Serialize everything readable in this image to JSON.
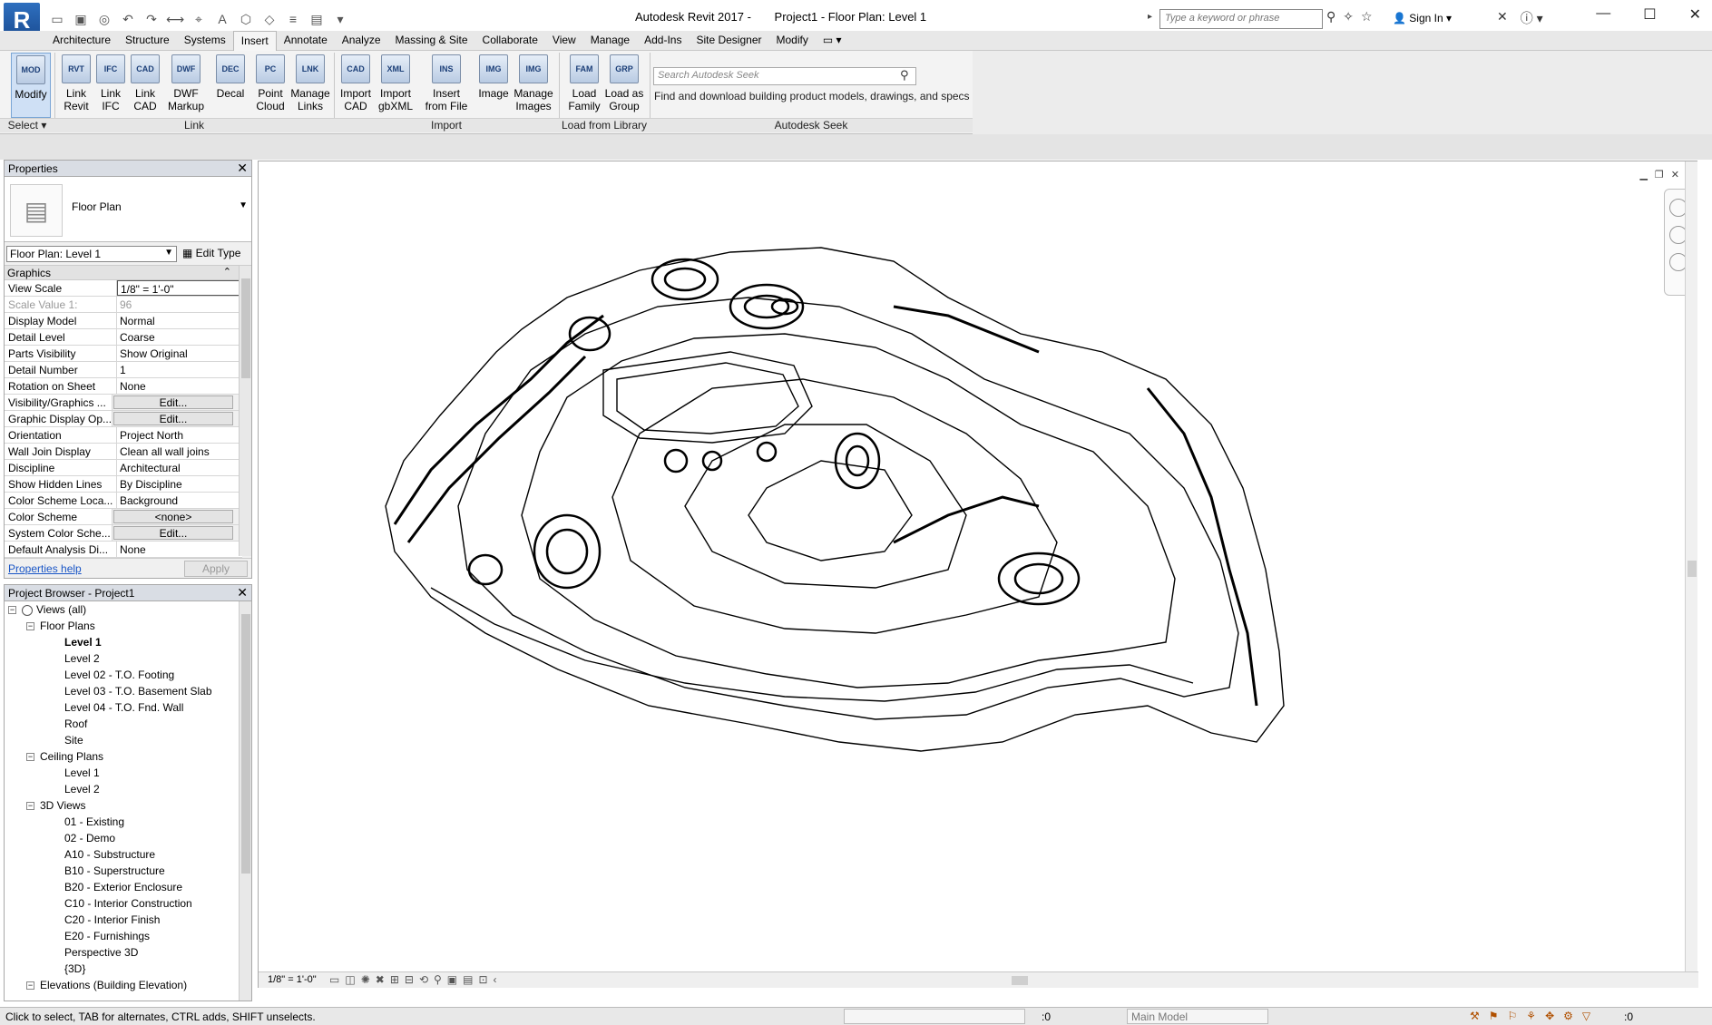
{
  "window": {
    "app_name": "Autodesk Revit 2017 -",
    "doc_title": "Project1 - Floor Plan: Level 1",
    "search_placeholder": "Type a keyword or phrase",
    "sign_in": "Sign In"
  },
  "ribbon_tabs": [
    "Architecture",
    "Structure",
    "Systems",
    "Insert",
    "Annotate",
    "Analyze",
    "Massing & Site",
    "Collaborate",
    "View",
    "Manage",
    "Add-Ins",
    "Site Designer",
    "Modify"
  ],
  "active_tab": "Insert",
  "ribbon": {
    "buttons": [
      {
        "label": "Modify",
        "icon": "MOD"
      },
      {
        "label": "Link Revit",
        "icon": "RVT"
      },
      {
        "label": "Link IFC",
        "icon": "IFC"
      },
      {
        "label": "Link CAD",
        "icon": "CAD"
      },
      {
        "label": "DWF Markup",
        "icon": "DWF"
      },
      {
        "label": "Decal",
        "icon": "DEC"
      },
      {
        "label": "Point Cloud",
        "icon": "PC"
      },
      {
        "label": "Manage Links",
        "icon": "LNK"
      },
      {
        "label": "Import CAD",
        "icon": "CAD"
      },
      {
        "label": "Import gbXML",
        "icon": "XML"
      },
      {
        "label": "Insert from File",
        "icon": "INS"
      },
      {
        "label": "Image",
        "icon": "IMG"
      },
      {
        "label": "Manage Images",
        "icon": "IMG"
      },
      {
        "label": "Load Family",
        "icon": "FAM"
      },
      {
        "label": "Load as Group",
        "icon": "GRP"
      }
    ],
    "panels": [
      "Select",
      "Link",
      "Import",
      "Load from Library",
      "Autodesk Seek"
    ],
    "seek_placeholder": "Search Autodesk Seek",
    "seek_description": "Find and download building product models, drawings, and specs"
  },
  "properties": {
    "title": "Properties",
    "type_name": "Floor Plan",
    "instance": "Floor Plan: Level 1",
    "edit_type": "Edit Type",
    "group": "Graphics",
    "rows": [
      {
        "name": "View Scale",
        "value": "1/8\" = 1'-0\""
      },
      {
        "name": "Scale Value    1:",
        "value": "96"
      },
      {
        "name": "Display Model",
        "value": "Normal"
      },
      {
        "name": "Detail Level",
        "value": "Coarse"
      },
      {
        "name": "Parts Visibility",
        "value": "Show Original"
      },
      {
        "name": "Detail Number",
        "value": "1"
      },
      {
        "name": "Rotation on Sheet",
        "value": "None"
      },
      {
        "name": "Visibility/Graphics ...",
        "value": "Edit..."
      },
      {
        "name": "Graphic Display Op...",
        "value": "Edit..."
      },
      {
        "name": "Orientation",
        "value": "Project North"
      },
      {
        "name": "Wall Join Display",
        "value": "Clean all wall joins"
      },
      {
        "name": "Discipline",
        "value": "Architectural"
      },
      {
        "name": "Show Hidden Lines",
        "value": "By Discipline"
      },
      {
        "name": "Color Scheme Loca...",
        "value": "Background"
      },
      {
        "name": "Color Scheme",
        "value": "<none>"
      },
      {
        "name": "System Color Sche...",
        "value": "Edit..."
      },
      {
        "name": "Default Analysis Di...",
        "value": "None"
      }
    ],
    "help": "Properties help",
    "apply": "Apply"
  },
  "browser": {
    "title": "Project Browser - Project1",
    "nodes": [
      {
        "label": "Views (all)",
        "level": 0,
        "exp": "−"
      },
      {
        "label": "Floor Plans",
        "level": 1,
        "exp": "−"
      },
      {
        "label": "Level 1",
        "level": 2
      },
      {
        "label": "Level 2",
        "level": 2
      },
      {
        "label": "Level 02 - T.O. Footing",
        "level": 2
      },
      {
        "label": "Level 03 - T.O. Basement Slab",
        "level": 2
      },
      {
        "label": "Level 04 - T.O. Fnd. Wall",
        "level": 2
      },
      {
        "label": "Roof",
        "level": 2
      },
      {
        "label": "Site",
        "level": 2
      },
      {
        "label": "Ceiling Plans",
        "level": 1,
        "exp": "−"
      },
      {
        "label": "Level 1",
        "level": 2
      },
      {
        "label": "Level 2",
        "level": 2
      },
      {
        "label": "3D Views",
        "level": 1,
        "exp": "−"
      },
      {
        "label": "01 - Existing",
        "level": 2
      },
      {
        "label": "02 - Demo",
        "level": 2
      },
      {
        "label": "A10 - Substructure",
        "level": 2
      },
      {
        "label": "B10 - Superstructure",
        "level": 2
      },
      {
        "label": "B20 - Exterior Enclosure",
        "level": 2
      },
      {
        "label": "C10 - Interior Construction",
        "level": 2
      },
      {
        "label": "C20 - Interior Finish",
        "level": 2
      },
      {
        "label": "E20 - Furnishings",
        "level": 2
      },
      {
        "label": "Perspective 3D",
        "level": 2
      },
      {
        "label": "{3D}",
        "level": 2
      },
      {
        "label": "Elevations (Building Elevation)",
        "level": 1,
        "exp": "−"
      }
    ]
  },
  "view_bar": {
    "scale": "1/8\" = 1'-0\""
  },
  "status": {
    "message": "Click to select, TAB for alternates, CTRL adds, SHIFT unselects.",
    "filter_count": ":0",
    "model": "Main Model",
    "selection_count": ":0"
  }
}
